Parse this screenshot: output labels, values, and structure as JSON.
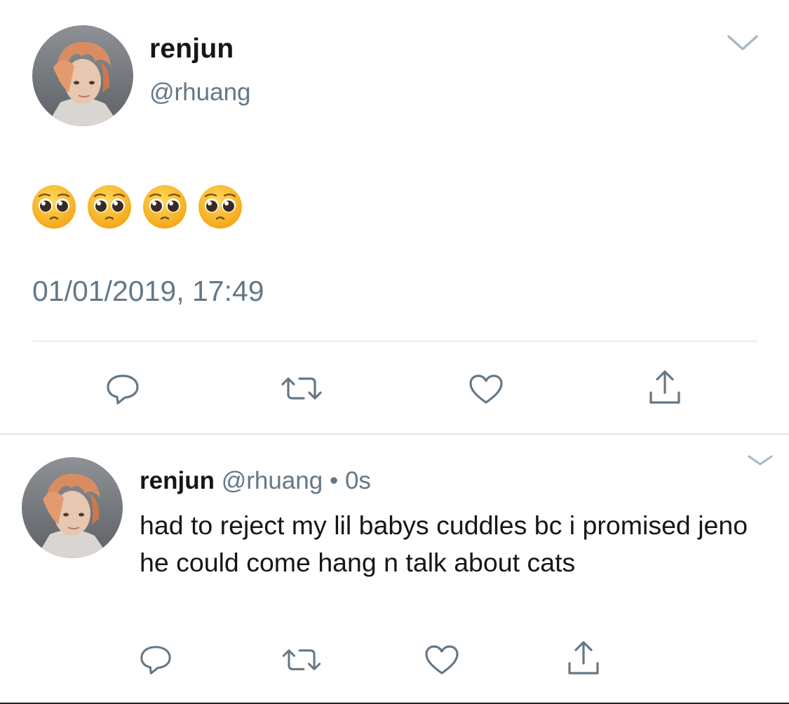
{
  "main_tweet": {
    "display_name": "renjun",
    "handle": "@rhuang",
    "emojis": [
      "pleading-face-emoji",
      "pleading-face-emoji",
      "pleading-face-emoji",
      "pleading-face-emoji"
    ],
    "timestamp": "01/01/2019, 17:49",
    "actions": [
      "reply-icon",
      "retweet-icon",
      "like-icon",
      "share-icon"
    ]
  },
  "reply_tweet": {
    "display_name": "renjun",
    "handle": "@rhuang",
    "separator": "•",
    "time": "0s",
    "text": "had to reject my lil babys cuddles bc i promised jeno he could come hang n talk about cats",
    "actions": [
      "reply-icon",
      "retweet-icon",
      "like-icon",
      "share-icon"
    ]
  },
  "colors": {
    "text_primary": "#14171a",
    "text_secondary": "#657786",
    "divider": "#e1e6ea",
    "chevron": "#aab8c2"
  }
}
